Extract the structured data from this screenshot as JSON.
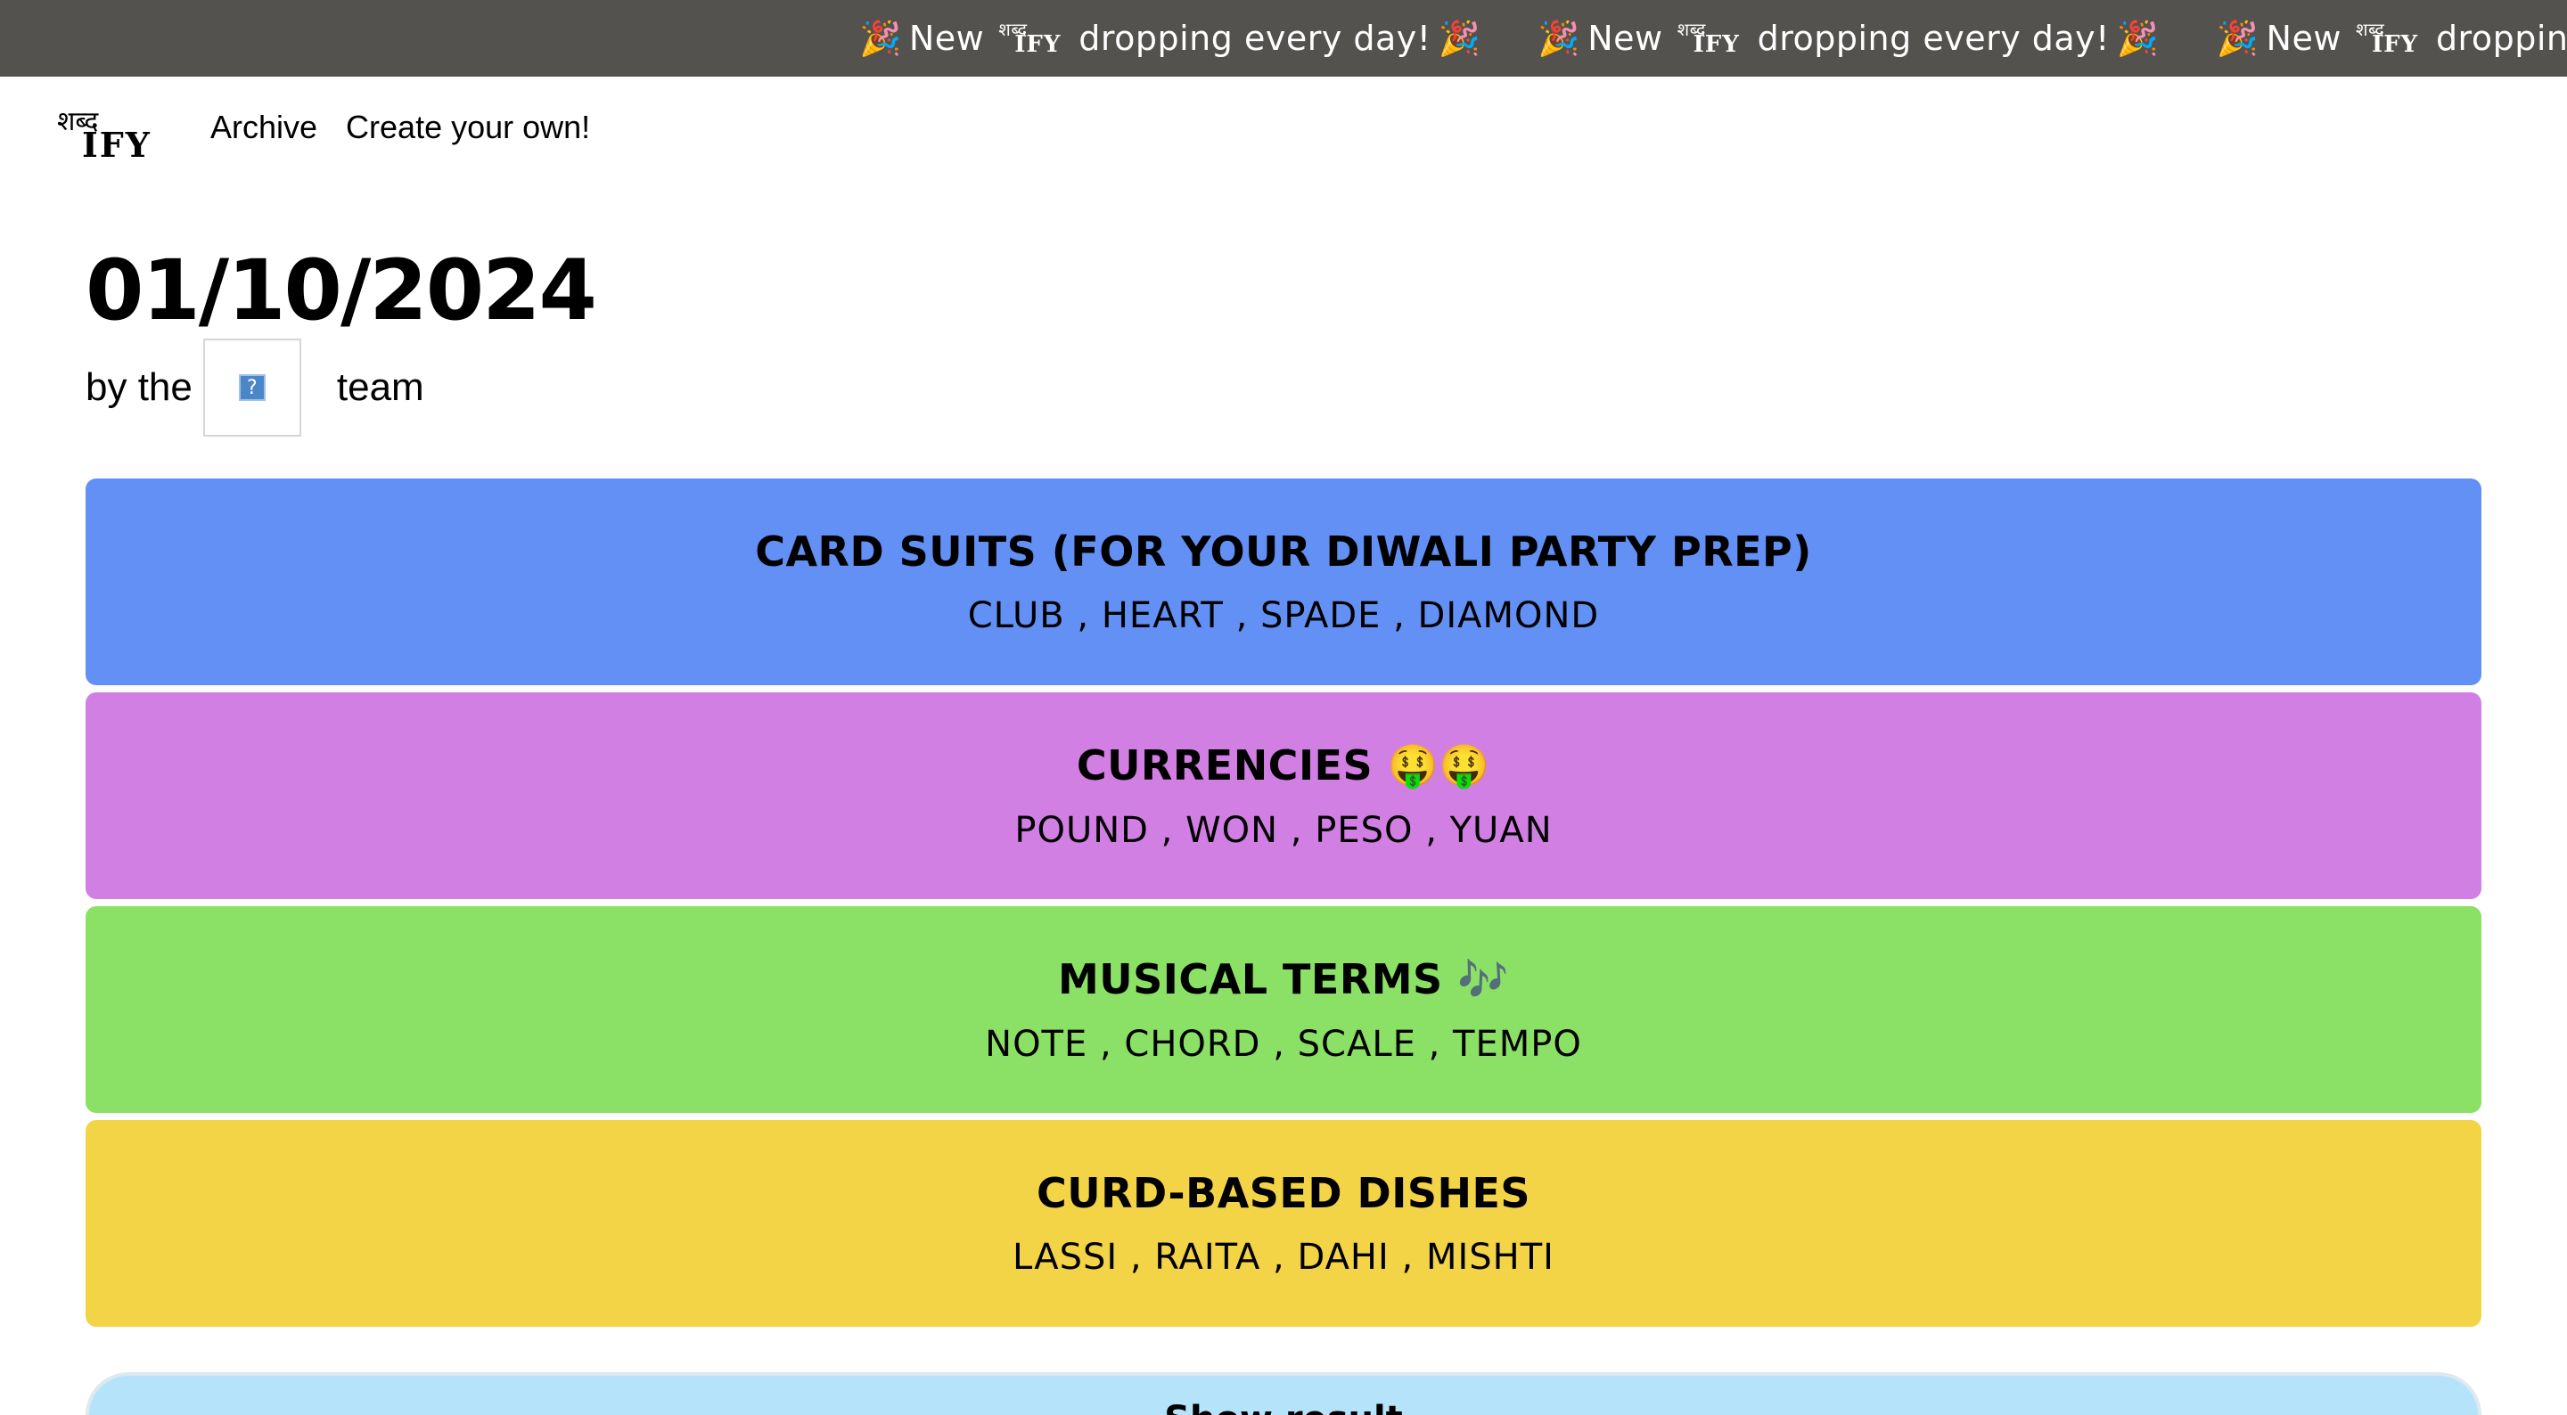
{
  "ticker": {
    "items": [
      {
        "emoji_start": "🎉",
        "text_before": "New",
        "logo_deva": "शब्द",
        "logo_ify": "IFY",
        "text_after": "dropping every day!",
        "emoji_end": "🎉"
      },
      {
        "emoji_start": "🎉",
        "text_before": "New",
        "logo_deva": "शब्द",
        "logo_ify": "IFY",
        "text_after": "dropping every day!",
        "emoji_end": "🎉"
      },
      {
        "emoji_start": "🎉",
        "text_before": "New",
        "logo_deva": "शब्द",
        "logo_ify": "IFY",
        "text_after": "dropping every day!",
        "emoji_end": "🎉"
      }
    ],
    "background": "#53524e"
  },
  "logo": {
    "deva": "शब्द",
    "ify": "IFY"
  },
  "nav": {
    "archive": "Archive",
    "create": "Create your own!"
  },
  "puzzle": {
    "date": "01/10/2024",
    "by_prefix": "by the",
    "by_suffix": "team",
    "team_image_icon": "broken-image-icon",
    "broken_glyph": "?"
  },
  "categories": [
    {
      "title": "CARD SUITS (FOR YOUR DIWALI PARTY PREP)",
      "words": "CLUB , HEART , SPADE , DIAMOND",
      "color": "#6390f5"
    },
    {
      "title": "CURRENCIES 🤑🤑",
      "words": "POUND , WON , PESO , YUAN",
      "color": "#d27fe4"
    },
    {
      "title": "MUSICAL TERMS 🎶",
      "words": "NOTE , CHORD , SCALE , TEMPO",
      "color": "#8be066"
    },
    {
      "title": "CURD-BASED DISHES",
      "words": "LASSI , RAITA , DAHI , MISHTI",
      "color": "#f3d447"
    }
  ],
  "result": {
    "label": "Show result",
    "color": "#b5e3f9"
  }
}
